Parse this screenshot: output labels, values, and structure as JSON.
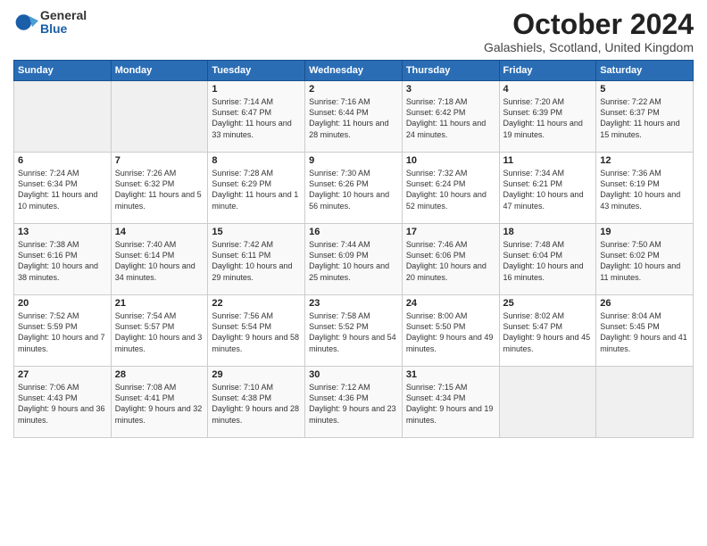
{
  "logo": {
    "general": "General",
    "blue": "Blue"
  },
  "title": "October 2024",
  "subtitle": "Galashiels, Scotland, United Kingdom",
  "header_days": [
    "Sunday",
    "Monday",
    "Tuesday",
    "Wednesday",
    "Thursday",
    "Friday",
    "Saturday"
  ],
  "weeks": [
    [
      {
        "day": "",
        "sunrise": "",
        "sunset": "",
        "daylight": ""
      },
      {
        "day": "",
        "sunrise": "",
        "sunset": "",
        "daylight": ""
      },
      {
        "day": "1",
        "sunrise": "Sunrise: 7:14 AM",
        "sunset": "Sunset: 6:47 PM",
        "daylight": "Daylight: 11 hours and 33 minutes."
      },
      {
        "day": "2",
        "sunrise": "Sunrise: 7:16 AM",
        "sunset": "Sunset: 6:44 PM",
        "daylight": "Daylight: 11 hours and 28 minutes."
      },
      {
        "day": "3",
        "sunrise": "Sunrise: 7:18 AM",
        "sunset": "Sunset: 6:42 PM",
        "daylight": "Daylight: 11 hours and 24 minutes."
      },
      {
        "day": "4",
        "sunrise": "Sunrise: 7:20 AM",
        "sunset": "Sunset: 6:39 PM",
        "daylight": "Daylight: 11 hours and 19 minutes."
      },
      {
        "day": "5",
        "sunrise": "Sunrise: 7:22 AM",
        "sunset": "Sunset: 6:37 PM",
        "daylight": "Daylight: 11 hours and 15 minutes."
      }
    ],
    [
      {
        "day": "6",
        "sunrise": "Sunrise: 7:24 AM",
        "sunset": "Sunset: 6:34 PM",
        "daylight": "Daylight: 11 hours and 10 minutes."
      },
      {
        "day": "7",
        "sunrise": "Sunrise: 7:26 AM",
        "sunset": "Sunset: 6:32 PM",
        "daylight": "Daylight: 11 hours and 5 minutes."
      },
      {
        "day": "8",
        "sunrise": "Sunrise: 7:28 AM",
        "sunset": "Sunset: 6:29 PM",
        "daylight": "Daylight: 11 hours and 1 minute."
      },
      {
        "day": "9",
        "sunrise": "Sunrise: 7:30 AM",
        "sunset": "Sunset: 6:26 PM",
        "daylight": "Daylight: 10 hours and 56 minutes."
      },
      {
        "day": "10",
        "sunrise": "Sunrise: 7:32 AM",
        "sunset": "Sunset: 6:24 PM",
        "daylight": "Daylight: 10 hours and 52 minutes."
      },
      {
        "day": "11",
        "sunrise": "Sunrise: 7:34 AM",
        "sunset": "Sunset: 6:21 PM",
        "daylight": "Daylight: 10 hours and 47 minutes."
      },
      {
        "day": "12",
        "sunrise": "Sunrise: 7:36 AM",
        "sunset": "Sunset: 6:19 PM",
        "daylight": "Daylight: 10 hours and 43 minutes."
      }
    ],
    [
      {
        "day": "13",
        "sunrise": "Sunrise: 7:38 AM",
        "sunset": "Sunset: 6:16 PM",
        "daylight": "Daylight: 10 hours and 38 minutes."
      },
      {
        "day": "14",
        "sunrise": "Sunrise: 7:40 AM",
        "sunset": "Sunset: 6:14 PM",
        "daylight": "Daylight: 10 hours and 34 minutes."
      },
      {
        "day": "15",
        "sunrise": "Sunrise: 7:42 AM",
        "sunset": "Sunset: 6:11 PM",
        "daylight": "Daylight: 10 hours and 29 minutes."
      },
      {
        "day": "16",
        "sunrise": "Sunrise: 7:44 AM",
        "sunset": "Sunset: 6:09 PM",
        "daylight": "Daylight: 10 hours and 25 minutes."
      },
      {
        "day": "17",
        "sunrise": "Sunrise: 7:46 AM",
        "sunset": "Sunset: 6:06 PM",
        "daylight": "Daylight: 10 hours and 20 minutes."
      },
      {
        "day": "18",
        "sunrise": "Sunrise: 7:48 AM",
        "sunset": "Sunset: 6:04 PM",
        "daylight": "Daylight: 10 hours and 16 minutes."
      },
      {
        "day": "19",
        "sunrise": "Sunrise: 7:50 AM",
        "sunset": "Sunset: 6:02 PM",
        "daylight": "Daylight: 10 hours and 11 minutes."
      }
    ],
    [
      {
        "day": "20",
        "sunrise": "Sunrise: 7:52 AM",
        "sunset": "Sunset: 5:59 PM",
        "daylight": "Daylight: 10 hours and 7 minutes."
      },
      {
        "day": "21",
        "sunrise": "Sunrise: 7:54 AM",
        "sunset": "Sunset: 5:57 PM",
        "daylight": "Daylight: 10 hours and 3 minutes."
      },
      {
        "day": "22",
        "sunrise": "Sunrise: 7:56 AM",
        "sunset": "Sunset: 5:54 PM",
        "daylight": "Daylight: 9 hours and 58 minutes."
      },
      {
        "day": "23",
        "sunrise": "Sunrise: 7:58 AM",
        "sunset": "Sunset: 5:52 PM",
        "daylight": "Daylight: 9 hours and 54 minutes."
      },
      {
        "day": "24",
        "sunrise": "Sunrise: 8:00 AM",
        "sunset": "Sunset: 5:50 PM",
        "daylight": "Daylight: 9 hours and 49 minutes."
      },
      {
        "day": "25",
        "sunrise": "Sunrise: 8:02 AM",
        "sunset": "Sunset: 5:47 PM",
        "daylight": "Daylight: 9 hours and 45 minutes."
      },
      {
        "day": "26",
        "sunrise": "Sunrise: 8:04 AM",
        "sunset": "Sunset: 5:45 PM",
        "daylight": "Daylight: 9 hours and 41 minutes."
      }
    ],
    [
      {
        "day": "27",
        "sunrise": "Sunrise: 7:06 AM",
        "sunset": "Sunset: 4:43 PM",
        "daylight": "Daylight: 9 hours and 36 minutes."
      },
      {
        "day": "28",
        "sunrise": "Sunrise: 7:08 AM",
        "sunset": "Sunset: 4:41 PM",
        "daylight": "Daylight: 9 hours and 32 minutes."
      },
      {
        "day": "29",
        "sunrise": "Sunrise: 7:10 AM",
        "sunset": "Sunset: 4:38 PM",
        "daylight": "Daylight: 9 hours and 28 minutes."
      },
      {
        "day": "30",
        "sunrise": "Sunrise: 7:12 AM",
        "sunset": "Sunset: 4:36 PM",
        "daylight": "Daylight: 9 hours and 23 minutes."
      },
      {
        "day": "31",
        "sunrise": "Sunrise: 7:15 AM",
        "sunset": "Sunset: 4:34 PM",
        "daylight": "Daylight: 9 hours and 19 minutes."
      },
      {
        "day": "",
        "sunrise": "",
        "sunset": "",
        "daylight": ""
      },
      {
        "day": "",
        "sunrise": "",
        "sunset": "",
        "daylight": ""
      }
    ]
  ]
}
